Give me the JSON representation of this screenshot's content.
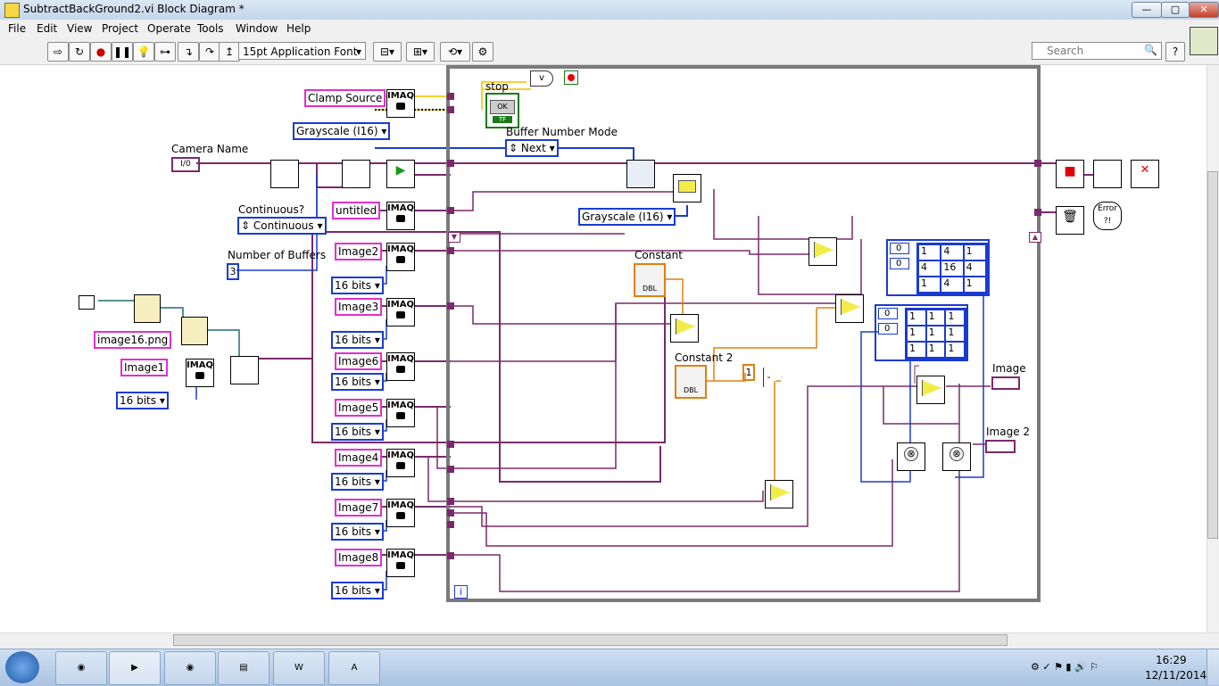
{
  "window": {
    "title": "SubtractBackGround2.vi Block Diagram *",
    "min": "—",
    "max": "▢",
    "close": "✕"
  },
  "menu": [
    "File",
    "Edit",
    "View",
    "Project",
    "Operate",
    "Tools",
    "Window",
    "Help"
  ],
  "toolbar": {
    "font": "15pt Application Font",
    "search_placeholder": "Search",
    "help": "?"
  },
  "diagram": {
    "stop": "stop",
    "ok": "OK",
    "tf": "TF",
    "buffer_number_mode": "Buffer Number Mode",
    "next": "Next",
    "clamp_source": "Clamp Source",
    "grayscale_1": "Grayscale (I16)",
    "grayscale_2": "Grayscale (I16)",
    "camera_name": "Camera Name",
    "io": "I/0",
    "continuous_q": "Continuous?",
    "continuous": "Continuous",
    "untitled": "untitled",
    "number_of_buffers": "Number of Buffers",
    "buffers_value": "3",
    "image2": "Image2",
    "image3": "Image3",
    "image6": "Image6",
    "image5": "Image5",
    "image4": "Image4",
    "image7": "Image7",
    "image8": "Image8",
    "image1": "Image1",
    "image16": "image16.png",
    "bits": "16 bits",
    "constant": "Constant",
    "constant2": "Constant 2",
    "dbl": "DBL",
    "one": "1",
    "image_out": "Image",
    "image2_out": "Image 2",
    "imaq": "IMAQ",
    "error": "Error ?!",
    "matrix1_index": [
      "0",
      "0"
    ],
    "matrix1": [
      "1",
      "4",
      "1",
      "4",
      "16",
      "4",
      "1",
      "4",
      "1"
    ],
    "matrix2_index": [
      "0",
      "0"
    ],
    "matrix2": [
      "1",
      "1",
      "1",
      "1",
      "1",
      "1",
      "1",
      "1",
      "1"
    ],
    "loop_i": "i"
  },
  "taskbar": {
    "time": "16:29",
    "date": "12/11/2014"
  }
}
